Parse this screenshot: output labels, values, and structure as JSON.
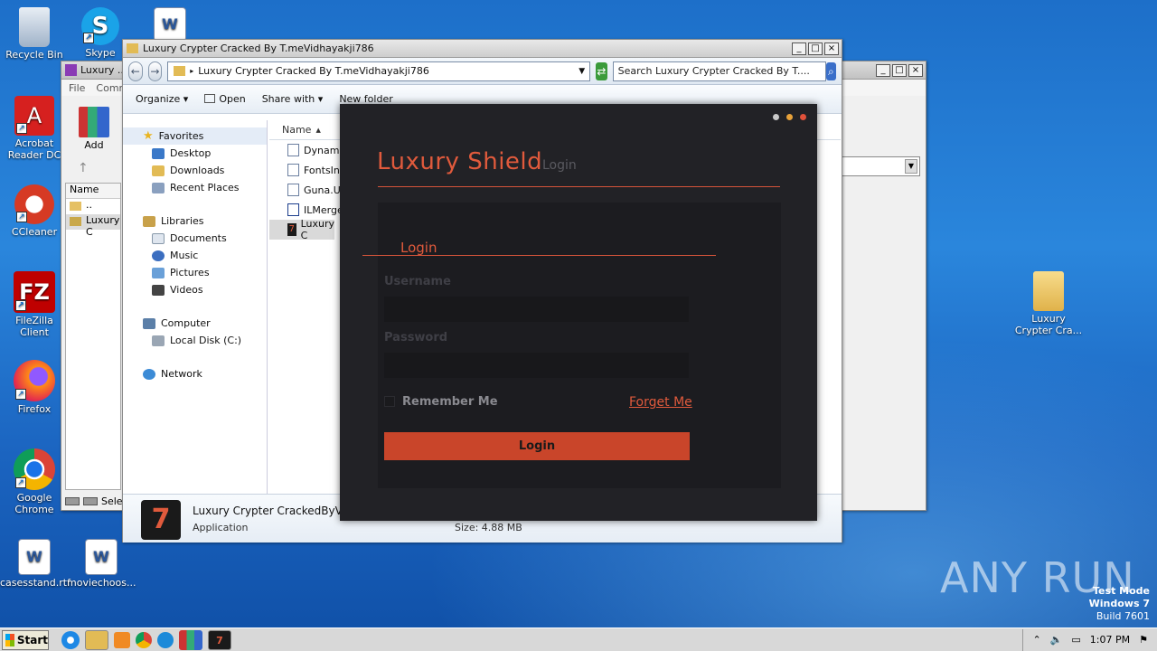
{
  "desktop": {
    "icons": [
      {
        "label": "Recycle Bin"
      },
      {
        "label": "Skype"
      },
      {
        "label": "Acrobat Reader DC"
      },
      {
        "label": "CCleaner"
      },
      {
        "label": "FileZilla Client"
      },
      {
        "label": "Firefox"
      },
      {
        "label": "Google Chrome"
      },
      {
        "label": "casesstand.rtf"
      },
      {
        "label": "moviechoos..."
      },
      {
        "label": "Luxury Crypter Cra..."
      }
    ]
  },
  "back_window": {
    "title": "Luxury ...",
    "menu": [
      "File",
      "Comm"
    ],
    "tool_label": "Add",
    "list_header": "Name",
    "list_items": [
      "..",
      "Luxury C"
    ],
    "status": "Sele"
  },
  "explorer": {
    "title": "Luxury Crypter Cracked By T.meVidhayakji786",
    "address": "Luxury Crypter Cracked By T.meVidhayakji786",
    "search_placeholder": "Search Luxury Crypter Cracked By T....",
    "commands": [
      "Organize",
      "Open",
      "Share with",
      "New folder"
    ],
    "nav": {
      "favorites": "Favorites",
      "favorites_items": [
        "Desktop",
        "Downloads",
        "Recent Places"
      ],
      "libraries": "Libraries",
      "libraries_items": [
        "Documents",
        "Music",
        "Pictures",
        "Videos"
      ],
      "computer": "Computer",
      "computer_items": [
        "Local Disk (C:)"
      ],
      "network": "Network"
    },
    "column_name": "Name",
    "files": [
      "Dynamite",
      "FontsIns",
      "Guna.UI2",
      "ILMerge.",
      "Luxury C"
    ],
    "detail": {
      "name": "Luxury Crypter CrackedByVidh",
      "type": "Application",
      "size": "Size: 4.88 MB"
    }
  },
  "login_app": {
    "title": "Luxury Shield",
    "subtitle": "Login",
    "card_title": "Login",
    "username_label": "Username",
    "password_label": "Password",
    "remember_label": "Remember Me",
    "forget_label": "Forget Me",
    "button_label": "Login",
    "colors": {
      "accent": "#e05a3c",
      "button": "#c9452a",
      "bg": "#222226"
    }
  },
  "taskbar": {
    "start_label": "Start",
    "time": "1:07 PM"
  },
  "watermark": {
    "brand": "ANY RUN",
    "line1": "Test Mode",
    "line2": "Windows 7",
    "line3": "Build 7601"
  }
}
